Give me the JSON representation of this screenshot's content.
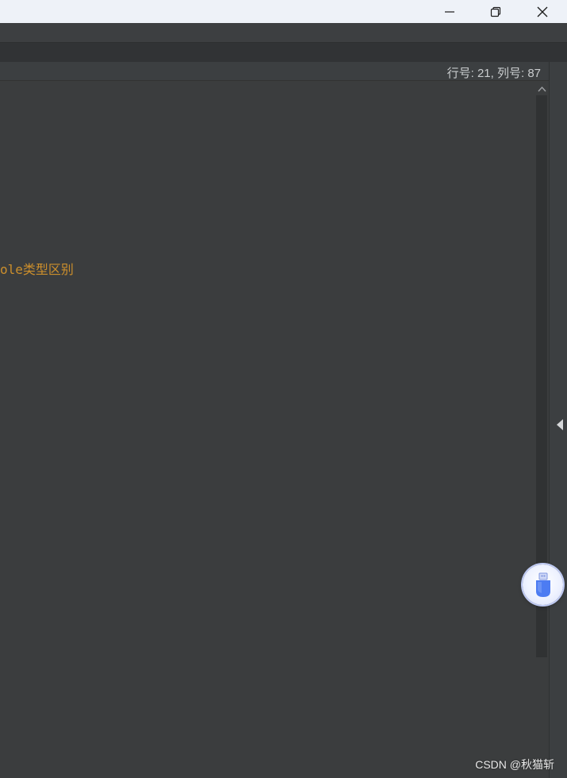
{
  "window": {
    "controls": {
      "minimize_icon": "minimize-icon",
      "restore_icon": "restore-icon",
      "close_icon": "close-icon"
    }
  },
  "status": {
    "cursor_position": "行号: 21, 列号: 87"
  },
  "editor": {
    "visible_line_fragment": "ole类型区别",
    "text_color": "#cc8f2c",
    "background_color": "#3b3d3e"
  },
  "sidebar": {
    "collapse_icon": "triangle-left-icon"
  },
  "floating_widget": {
    "icon": "usb-drive-icon",
    "accent_color": "#4d7cf2"
  },
  "watermark": {
    "text": "CSDN @秋猫斩"
  }
}
